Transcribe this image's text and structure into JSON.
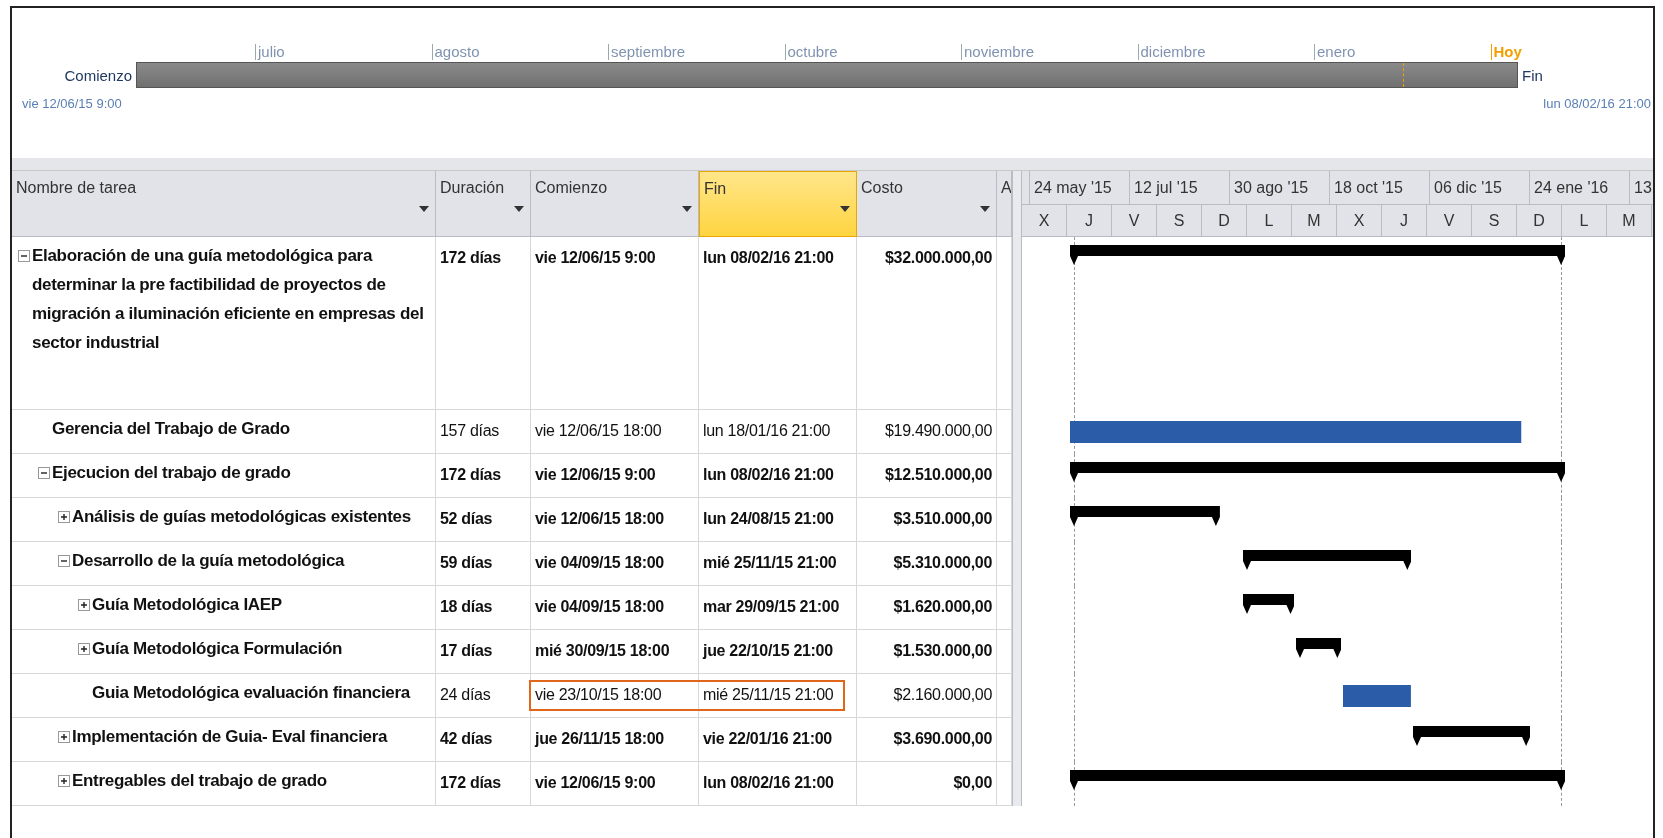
{
  "timeline": {
    "start_label": "Comienzo",
    "start_date": "vie 12/06/15 9:00",
    "end_label": "Fin",
    "end_date": "lun 08/02/16 21:00",
    "months": [
      "julio",
      "agosto",
      "septiembre",
      "octubre",
      "noviembre",
      "diciembre",
      "enero"
    ],
    "today": "Hoy"
  },
  "columns": [
    {
      "label": "Nombre de tarea",
      "selected": false,
      "filter": true
    },
    {
      "label": "Duración",
      "selected": false,
      "filter": true
    },
    {
      "label": "Comienzo",
      "selected": false,
      "filter": true
    },
    {
      "label": "Fin",
      "selected": true,
      "filter": true
    },
    {
      "label": "Costo",
      "selected": false,
      "filter": true
    },
    {
      "label": "A",
      "selected": false,
      "filter": false
    }
  ],
  "gantt": {
    "scale_upper": [
      "24 may '15",
      "12 jul '15",
      "30 ago '15",
      "18 oct '15",
      "06 dic '15",
      "24 ene '16",
      "13"
    ],
    "scale_lower": [
      "X",
      "J",
      "V",
      "S",
      "D",
      "L",
      "M",
      "X",
      "J",
      "V",
      "S",
      "D",
      "L",
      "M"
    ]
  },
  "tasks": [
    {
      "name": "Elaboración de una guía metodológica para determinar la pre factibilidad de proyectos de migración a iluminación eficiente en empresas del sector industrial",
      "duration": "172 días",
      "start": "vie 12/06/15 9:00",
      "finish": "lun 08/02/16 21:00",
      "cost": "$32.000.000,00",
      "summary": true,
      "expanded": true,
      "highlighted": false,
      "children": [
        {
          "name": "Gerencia del Trabajo de Grado",
          "duration": "157 días",
          "start": "vie 12/06/15 18:00",
          "finish": "lun 18/01/16 21:00",
          "cost": "$19.490.000,00",
          "summary": false,
          "highlighted": false
        },
        {
          "name": "Ejecucion del trabajo de grado",
          "duration": "172 días",
          "start": "vie 12/06/15 9:00",
          "finish": "lun 08/02/16 21:00",
          "cost": "$12.510.000,00",
          "summary": true,
          "expanded": true,
          "highlighted": false,
          "children": [
            {
              "name": "Análisis de guías metodológicas existentes",
              "duration": "52 días",
              "start": "vie 12/06/15 18:00",
              "finish": "lun 24/08/15 21:00",
              "cost": "$3.510.000,00",
              "summary": true,
              "expanded": false,
              "highlighted": false
            },
            {
              "name": "Desarrollo de la guía metodológica",
              "duration": "59 días",
              "start": "vie 04/09/15 18:00",
              "finish": "mié 25/11/15 21:00",
              "cost": "$5.310.000,00",
              "summary": true,
              "expanded": true,
              "highlighted": false,
              "children": [
                {
                  "name": "Guía Metodológica IAEP",
                  "duration": "18 días",
                  "start": "vie 04/09/15 18:00",
                  "finish": "mar 29/09/15 21:00",
                  "cost": "$1.620.000,00",
                  "summary": true,
                  "expanded": false,
                  "highlighted": false
                },
                {
                  "name": "Guía Metodológica Formulación",
                  "duration": "17 días",
                  "start": "mié 30/09/15 18:00",
                  "finish": "jue 22/10/15 21:00",
                  "cost": "$1.530.000,00",
                  "summary": true,
                  "expanded": false,
                  "highlighted": false
                },
                {
                  "name": "Guia Metodológica evaluación financiera",
                  "duration": "24 días",
                  "start": "vie 23/10/15 18:00",
                  "finish": "mié 25/11/15 21:00",
                  "cost": "$2.160.000,00",
                  "summary": false,
                  "highlighted": true
                }
              ]
            },
            {
              "name": "Implementación de Guia- Eval financiera",
              "duration": "42 días",
              "start": "jue 26/11/15 18:00",
              "finish": "vie 22/01/16 21:00",
              "cost": "$3.690.000,00",
              "summary": true,
              "expanded": false,
              "highlighted": false
            },
            {
              "name": "Entregables del trabajo de grado",
              "duration": "172 días",
              "start": "vie 12/06/15 9:00",
              "finish": "lun 08/02/16 21:00",
              "cost": "$0,00",
              "summary": true,
              "expanded": false,
              "highlighted": false
            }
          ]
        }
      ]
    }
  ]
}
